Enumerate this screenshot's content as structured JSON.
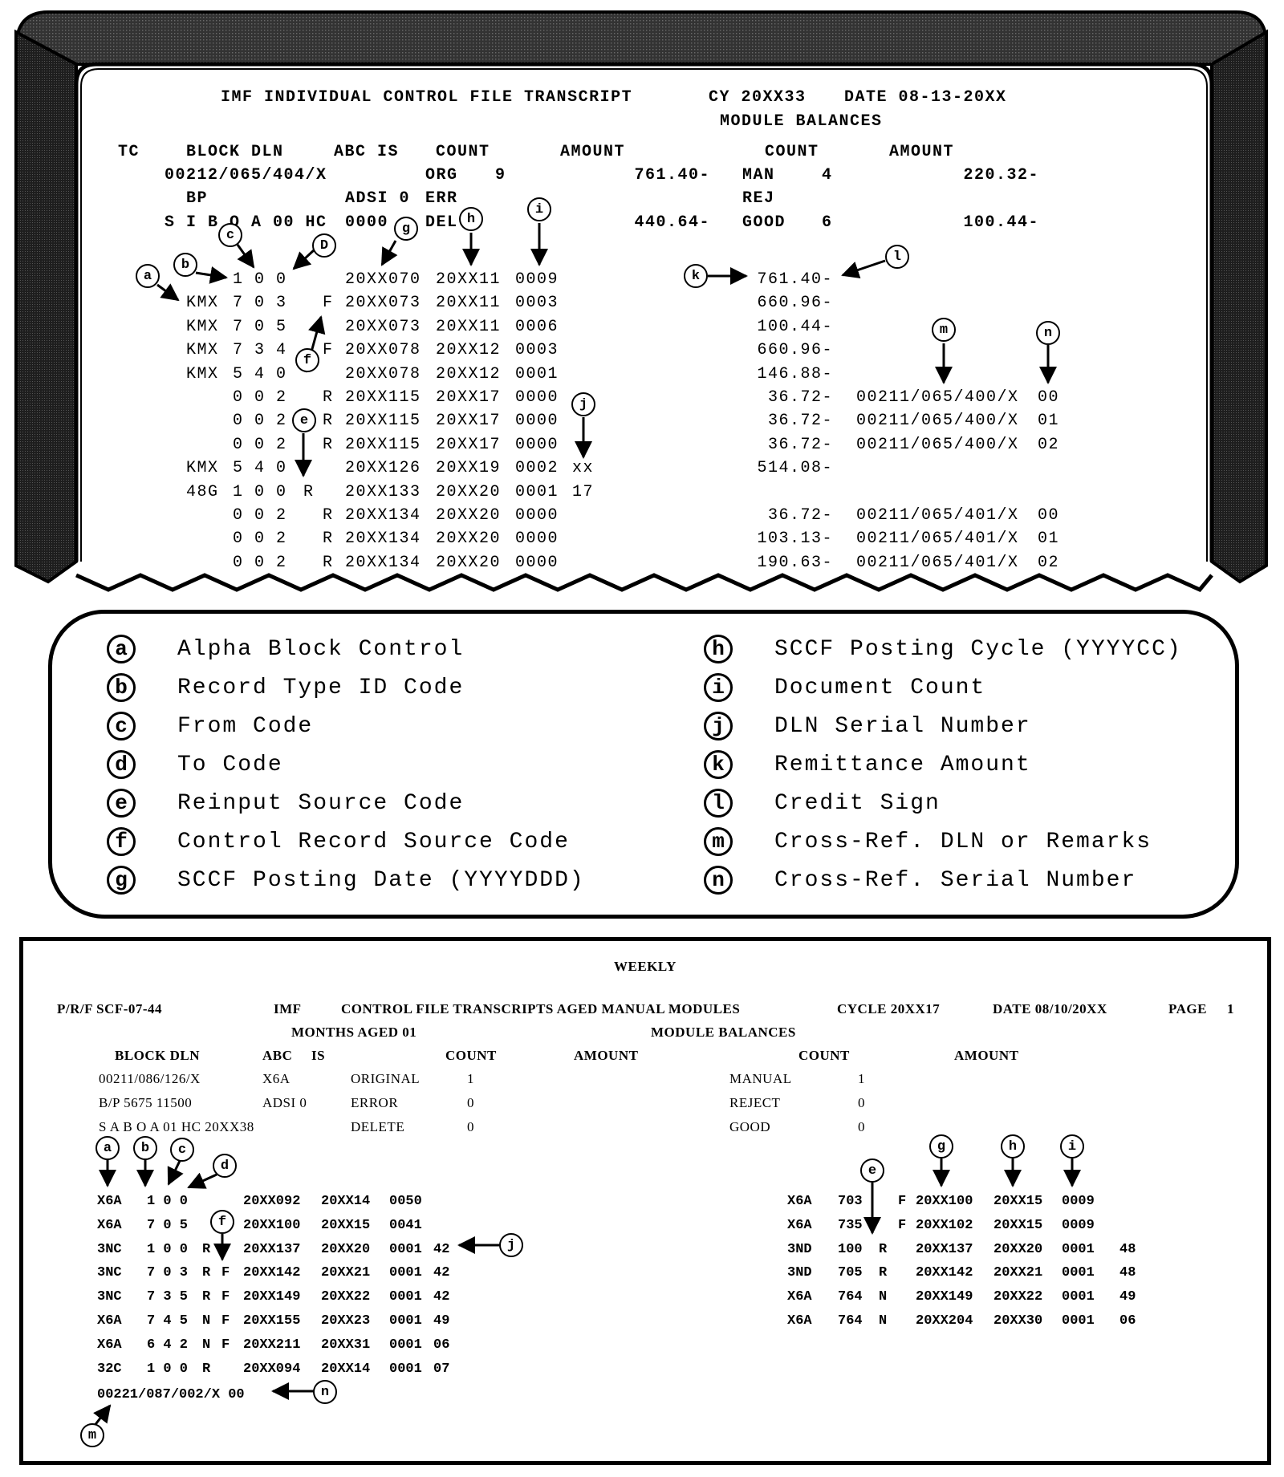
{
  "transcript": {
    "title": "IMF INDIVIDUAL CONTROL FILE TRANSCRIPT",
    "cycle": "CY 20XX33",
    "date": "DATE 08-13-20XX",
    "module_balances": "MODULE BALANCES",
    "headers": {
      "tc": "TC",
      "block_dln": "BLOCK DLN",
      "abc_is": "ABC IS",
      "count": "COUNT",
      "amount": "AMOUNT",
      "count2": "COUNT",
      "amount2": "AMOUNT"
    },
    "summary": [
      {
        "left": "00212/065/404/X",
        "mid": "",
        "label": "ORG",
        "count": "9",
        "amount": "761.40-",
        "label2": "MAN",
        "count2": "4",
        "amount2": "220.32-"
      },
      {
        "left": "BP",
        "mid": "ADSI 0",
        "label": "ERR",
        "count": "",
        "amount": "",
        "label2": "REJ",
        "count2": "",
        "amount2": ""
      },
      {
        "left": "S I B O A 00 HC",
        "mid": "0000",
        "label": "DEL",
        "count": "",
        "amount": "440.64-",
        "label2": "GOOD",
        "count2": "6",
        "amount2": "100.44-"
      }
    ],
    "rows": [
      {
        "abc": "",
        "codes": "1 0 0",
        "rsc": "",
        "crsc": "",
        "posting_date": "20XX070",
        "cycle": "20XX11",
        "doc_count": "0009",
        "serial": "",
        "amount": "761.40-",
        "xref_dln": "",
        "xref_serial": ""
      },
      {
        "abc": "KMX",
        "codes": "7 0 3",
        "rsc": "",
        "crsc": "F",
        "posting_date": "20XX073",
        "cycle": "20XX11",
        "doc_count": "0003",
        "serial": "",
        "amount": "660.96-",
        "xref_dln": "",
        "xref_serial": ""
      },
      {
        "abc": "KMX",
        "codes": "7 0 5",
        "rsc": "",
        "crsc": "",
        "posting_date": "20XX073",
        "cycle": "20XX11",
        "doc_count": "0006",
        "serial": "",
        "amount": "100.44-",
        "xref_dln": "",
        "xref_serial": ""
      },
      {
        "abc": "KMX",
        "codes": "7 3 4",
        "rsc": "",
        "crsc": "F",
        "posting_date": "20XX078",
        "cycle": "20XX12",
        "doc_count": "0003",
        "serial": "",
        "amount": "660.96-",
        "xref_dln": "",
        "xref_serial": ""
      },
      {
        "abc": "KMX",
        "codes": "5 4 0",
        "rsc": "",
        "crsc": "",
        "posting_date": "20XX078",
        "cycle": "20XX12",
        "doc_count": "0001",
        "serial": "",
        "amount": "146.88-",
        "xref_dln": "",
        "xref_serial": ""
      },
      {
        "abc": "",
        "codes": "0 0 2",
        "rsc": "",
        "crsc": "R",
        "posting_date": "20XX115",
        "cycle": "20XX17",
        "doc_count": "0000",
        "serial": "",
        "amount": "36.72-",
        "xref_dln": "00211/065/400/X",
        "xref_serial": "00"
      },
      {
        "abc": "",
        "codes": "0 0 2",
        "rsc": "",
        "crsc": "R",
        "posting_date": "20XX115",
        "cycle": "20XX17",
        "doc_count": "0000",
        "serial": "",
        "amount": "36.72-",
        "xref_dln": "00211/065/400/X",
        "xref_serial": "01"
      },
      {
        "abc": "",
        "codes": "0 0 2",
        "rsc": "",
        "crsc": "R",
        "posting_date": "20XX115",
        "cycle": "20XX17",
        "doc_count": "0000",
        "serial": "",
        "amount": "36.72-",
        "xref_dln": "00211/065/400/X",
        "xref_serial": "02"
      },
      {
        "abc": "KMX",
        "codes": "5 4 0",
        "rsc": "",
        "crsc": "",
        "posting_date": "20XX126",
        "cycle": "20XX19",
        "doc_count": "0002",
        "serial": "xx",
        "amount": "514.08-",
        "xref_dln": "",
        "xref_serial": ""
      },
      {
        "abc": "48G",
        "codes": "1 0 0",
        "rsc": "R",
        "crsc": "",
        "posting_date": "20XX133",
        "cycle": "20XX20",
        "doc_count": "0001",
        "serial": "17",
        "amount": "",
        "xref_dln": "",
        "xref_serial": ""
      },
      {
        "abc": "",
        "codes": "0 0 2",
        "rsc": "",
        "crsc": "R",
        "posting_date": "20XX134",
        "cycle": "20XX20",
        "doc_count": "0000",
        "serial": "",
        "amount": "36.72-",
        "xref_dln": "00211/065/401/X",
        "xref_serial": "00"
      },
      {
        "abc": "",
        "codes": "0 0 2",
        "rsc": "",
        "crsc": "R",
        "posting_date": "20XX134",
        "cycle": "20XX20",
        "doc_count": "0000",
        "serial": "",
        "amount": "103.13-",
        "xref_dln": "00211/065/401/X",
        "xref_serial": "01"
      },
      {
        "abc": "",
        "codes": "0 0 2",
        "rsc": "",
        "crsc": "R",
        "posting_date": "20XX134",
        "cycle": "20XX20",
        "doc_count": "0000",
        "serial": "",
        "amount": "190.63-",
        "xref_dln": "00211/065/401/X",
        "xref_serial": "02"
      }
    ],
    "callouts": [
      "a",
      "b",
      "c",
      "D",
      "e",
      "f",
      "g",
      "h",
      "i",
      "j",
      "k",
      "l",
      "m",
      "n"
    ]
  },
  "legend": {
    "items": [
      {
        "key": "a",
        "label": "Alpha Block Control"
      },
      {
        "key": "b",
        "label": "Record Type ID Code"
      },
      {
        "key": "c",
        "label": "From Code"
      },
      {
        "key": "d",
        "label": "To Code"
      },
      {
        "key": "e",
        "label": "Reinput Source Code"
      },
      {
        "key": "f",
        "label": "Control Record Source Code"
      },
      {
        "key": "g",
        "label": "SCCF Posting Date (YYYYDDD)"
      },
      {
        "key": "h",
        "label": "SCCF Posting Cycle (YYYYCC)"
      },
      {
        "key": "i",
        "label": "Document Count"
      },
      {
        "key": "j",
        "label": "DLN Serial Number"
      },
      {
        "key": "k",
        "label": "Remittance Amount"
      },
      {
        "key": "l",
        "label": "Credit Sign"
      },
      {
        "key": "m",
        "label": "Cross-Ref. DLN or Remarks"
      },
      {
        "key": "n",
        "label": "Cross-Ref. Serial Number"
      }
    ]
  },
  "weekly": {
    "heading": "WEEKLY",
    "prf": "P/R/F SCF-07-44",
    "imf": "IMF",
    "title": "CONTROL FILE TRANSCRIPTS AGED MANUAL MODULES",
    "cycle": "CYCLE 20XX17",
    "date": "DATE 08/10/20XX",
    "page_label": "PAGE",
    "page": "1",
    "months_aged": "MONTHS AGED 01",
    "module_balances": "MODULE BALANCES",
    "headers": {
      "block_dln": "BLOCK DLN",
      "abc": "ABC",
      "is": "IS",
      "count": "COUNT",
      "amount": "AMOUNT",
      "count2": "COUNT",
      "amount2": "AMOUNT"
    },
    "summary": [
      {
        "left": "00211/086/126/X",
        "abc": "X6A",
        "label": "ORIGINAL",
        "count": "1",
        "label2": "MANUAL",
        "count2": "1"
      },
      {
        "left": "B/P 5675 11500",
        "abc": "ADSI 0",
        "label": "ERROR",
        "count": "0",
        "label2": "REJECT",
        "count2": "0"
      },
      {
        "left": "S A B O A 01 HC 20XX38",
        "abc": "",
        "label": "DELETE",
        "count": "0",
        "label2": "GOOD",
        "count2": "0"
      }
    ],
    "left_rows": [
      {
        "abc": "X6A",
        "codes": "1 0 0",
        "rsc": "",
        "crsc": "",
        "date": "20XX092",
        "cycle": "20XX14",
        "count": "0050",
        "serial": ""
      },
      {
        "abc": "X6A",
        "codes": "7 0 5",
        "rsc": "",
        "crsc": "",
        "date": "20XX100",
        "cycle": "20XX15",
        "count": "0041",
        "serial": ""
      },
      {
        "abc": "3NC",
        "codes": "1 0 0",
        "rsc": "R",
        "crsc": "",
        "date": "20XX137",
        "cycle": "20XX20",
        "count": "0001",
        "serial": "42"
      },
      {
        "abc": "3NC",
        "codes": "7 0 3",
        "rsc": "R",
        "crsc": "F",
        "date": "20XX142",
        "cycle": "20XX21",
        "count": "0001",
        "serial": "42"
      },
      {
        "abc": "3NC",
        "codes": "7 3 5",
        "rsc": "R",
        "crsc": "F",
        "date": "20XX149",
        "cycle": "20XX22",
        "count": "0001",
        "serial": "42"
      },
      {
        "abc": "X6A",
        "codes": "7 4 5",
        "rsc": "N",
        "crsc": "F",
        "date": "20XX155",
        "cycle": "20XX23",
        "count": "0001",
        "serial": "49"
      },
      {
        "abc": "X6A",
        "codes": "6 4 2",
        "rsc": "N",
        "crsc": "F",
        "date": "20XX211",
        "cycle": "20XX31",
        "count": "0001",
        "serial": "06"
      },
      {
        "abc": "32C",
        "codes": "1 0 0",
        "rsc": "R",
        "crsc": "",
        "date": "20XX094",
        "cycle": "20XX14",
        "count": "0001",
        "serial": "07"
      }
    ],
    "xref_line": "00221/087/002/X 00",
    "right_rows": [
      {
        "abc": "X6A",
        "codes": "703",
        "rsc": "",
        "crsc": "F",
        "date": "20XX100",
        "cycle": "20XX15",
        "count": "0009",
        "serial": ""
      },
      {
        "abc": "X6A",
        "codes": "735",
        "rsc": "",
        "crsc": "F",
        "date": "20XX102",
        "cycle": "20XX15",
        "count": "0009",
        "serial": ""
      },
      {
        "abc": "3ND",
        "codes": "100",
        "rsc": "R",
        "crsc": "",
        "date": "20XX137",
        "cycle": "20XX20",
        "count": "0001",
        "serial": "48"
      },
      {
        "abc": "3ND",
        "codes": "705",
        "rsc": "R",
        "crsc": "",
        "date": "20XX142",
        "cycle": "20XX21",
        "count": "0001",
        "serial": "48"
      },
      {
        "abc": "X6A",
        "codes": "764",
        "rsc": "N",
        "crsc": "",
        "date": "20XX149",
        "cycle": "20XX22",
        "count": "0001",
        "serial": "49"
      },
      {
        "abc": "X6A",
        "codes": "764",
        "rsc": "N",
        "crsc": "",
        "date": "20XX204",
        "cycle": "20XX30",
        "count": "0001",
        "serial": "06"
      }
    ],
    "callouts": [
      "a",
      "b",
      "c",
      "d",
      "e",
      "f",
      "g",
      "h",
      "i",
      "j",
      "m",
      "n"
    ]
  }
}
